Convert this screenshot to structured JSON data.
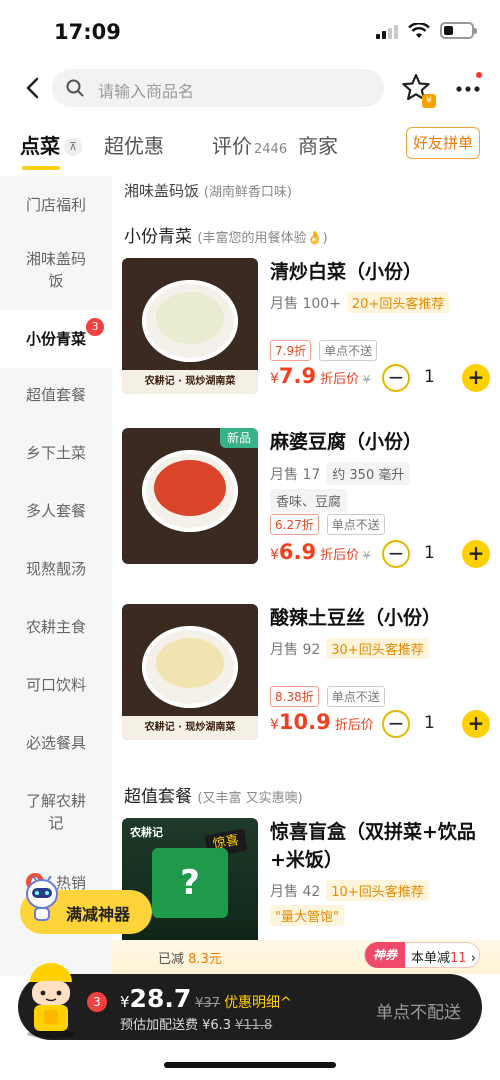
{
  "status": {
    "time": "17:09"
  },
  "search": {
    "placeholder": "请输入商品名"
  },
  "tabs": {
    "order": "点菜",
    "deals": "超优惠",
    "reviews": "评价",
    "review_count": "2446",
    "merchant": "商家",
    "group_order": "好友拼单"
  },
  "sidebar": {
    "items": [
      {
        "label": "门店福利"
      },
      {
        "label": "湘味盖码饭"
      },
      {
        "label": "小份青菜",
        "badge": "3"
      },
      {
        "label": "超值套餐"
      },
      {
        "label": "乡下土菜"
      },
      {
        "label": "多人套餐"
      },
      {
        "label": "现熬靓汤"
      },
      {
        "label": "农耕主食"
      },
      {
        "label": "可口饮料"
      },
      {
        "label": "必选餐具"
      },
      {
        "label": "了解农耕记"
      },
      {
        "label": "热销"
      }
    ]
  },
  "sections": {
    "rice": {
      "title": "湘味盖码饭",
      "subtitle": "(湖南鲜香口味)"
    },
    "greens": {
      "title": "小份青菜",
      "subtitle": "(丰富您的用餐体验👌)"
    },
    "combo": {
      "title": "超值套餐",
      "subtitle": "(又丰富 又实惠噢)"
    }
  },
  "items": [
    {
      "name": "清炒白菜（小份）",
      "monthly": "月售 100+",
      "rec": "20+回头客推荐",
      "discount": "7.9折",
      "no_delivery": "单点不送",
      "currency": "¥",
      "price": "7.9",
      "after_label": "折后价",
      "orig": "¥",
      "qty": "1",
      "band": "农耕记 · 现炒湖南菜"
    },
    {
      "name": "麻婆豆腐（小份）",
      "monthly": "月售 17",
      "volume": "约 350 毫升",
      "flavor": "香味、豆腐",
      "new": "新品",
      "discount": "6.27折",
      "no_delivery": "单点不送",
      "currency": "¥",
      "price": "6.9",
      "after_label": "折后价",
      "orig": "¥",
      "qty": "1"
    },
    {
      "name": "酸辣土豆丝（小份）",
      "monthly": "月售 92",
      "rec": "30+回头客推荐",
      "discount": "8.38折",
      "no_delivery": "单点不送",
      "currency": "¥",
      "price": "10.9",
      "after_label": "折后价",
      "orig": "¥",
      "qty": "1",
      "band": "农耕记 · 现炒湖南菜"
    },
    {
      "name": "惊喜盲盒（双拼菜+饮品+米饭）",
      "monthly": "月售 42",
      "rec": "10+回头客推荐",
      "tagline": "\"量大管饱\"",
      "brand": "农耕记",
      "surprise": "惊喜",
      "mark": "?"
    }
  ],
  "promo": {
    "full_reduce": "满减神器",
    "saved_label": "已减",
    "saved_value": "8.3元",
    "coupon_tag": "神券",
    "coupon_text": "本单减",
    "coupon_value": "11"
  },
  "cart": {
    "count": "3",
    "currency": "¥",
    "total": "28.7",
    "orig": "¥37",
    "detail": "优惠明细^",
    "fee": "预估加配送费 ¥6.3",
    "fee_orig": "¥11.8",
    "no_send": "单点不配送"
  }
}
